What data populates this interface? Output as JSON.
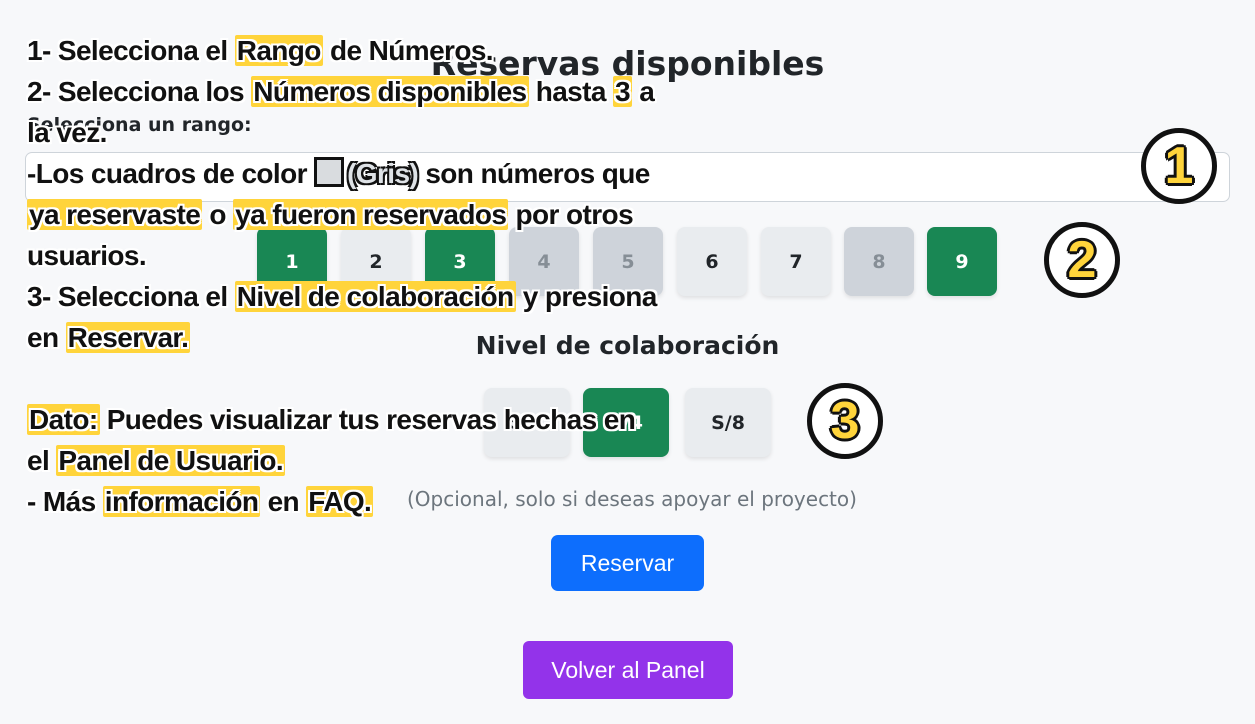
{
  "page": {
    "title": "Reservas disponibles",
    "range_label": "Selecciona un rango:",
    "range_select": {
      "value": ""
    }
  },
  "numbers": [
    {
      "label": "1",
      "state": "selected"
    },
    {
      "label": "2",
      "state": "free"
    },
    {
      "label": "3",
      "state": "selected"
    },
    {
      "label": "4",
      "state": "reserved"
    },
    {
      "label": "5",
      "state": "reserved"
    },
    {
      "label": "6",
      "state": "free"
    },
    {
      "label": "7",
      "state": "free"
    },
    {
      "label": "8",
      "state": "reserved"
    },
    {
      "label": "9",
      "state": "selected"
    }
  ],
  "collaboration": {
    "title": "Nivel de colaboración",
    "levels": [
      {
        "label": "S/2",
        "state": "free"
      },
      {
        "label": "S/4",
        "state": "selected"
      },
      {
        "label": "S/8",
        "state": "free"
      }
    ],
    "note": "(Opcional, solo si deseas apoyar el proyecto)"
  },
  "buttons": {
    "reserve": "Reservar",
    "back": "Volver al Panel"
  },
  "tutorial": {
    "step1_prefix": "1- Selecciona el ",
    "step1_hl": "Rango",
    "step1_suffix": " de Números.",
    "step2_prefix": "2- Selecciona los ",
    "step2_hl": "Números disponibles",
    "step2_mid": " hasta ",
    "step2_num": "3",
    "step2_suffix": " a",
    "step2_line2": "la vez.",
    "gray_prefix": "-Los cuadros de color ",
    "gray_word": "(Gris)",
    "gray_suffix": " son números que",
    "gray_hl1": "ya reservaste",
    "gray_mid": " o ",
    "gray_hl2": "ya fueron reservados",
    "gray_suffix2": " por otros",
    "gray_line3": "usuarios.",
    "step3_prefix": "3- Selecciona el ",
    "step3_hl": "Nivel de colaboración",
    "step3_suffix": " y presiona",
    "step3_line2_prefix": "en ",
    "step3_line2_hl": "Reservar.",
    "dato_hl": "Dato:",
    "dato_text": " Puedes visualizar tus reservas hechas en",
    "dato_line2_prefix": "el ",
    "dato_line2_hl": "Panel de Usuario.",
    "info_prefix": " - Más ",
    "info_hl": "información",
    "info_mid": " en ",
    "info_hl2": "FAQ."
  },
  "badges": [
    "1",
    "2",
    "3"
  ],
  "colors": {
    "selected": "#198754",
    "reserved": "#ced3da",
    "free": "#e9ecef",
    "reserve_button": "#0d6efd",
    "back_button": "#9333ea",
    "highlight": "#ffd43b"
  }
}
